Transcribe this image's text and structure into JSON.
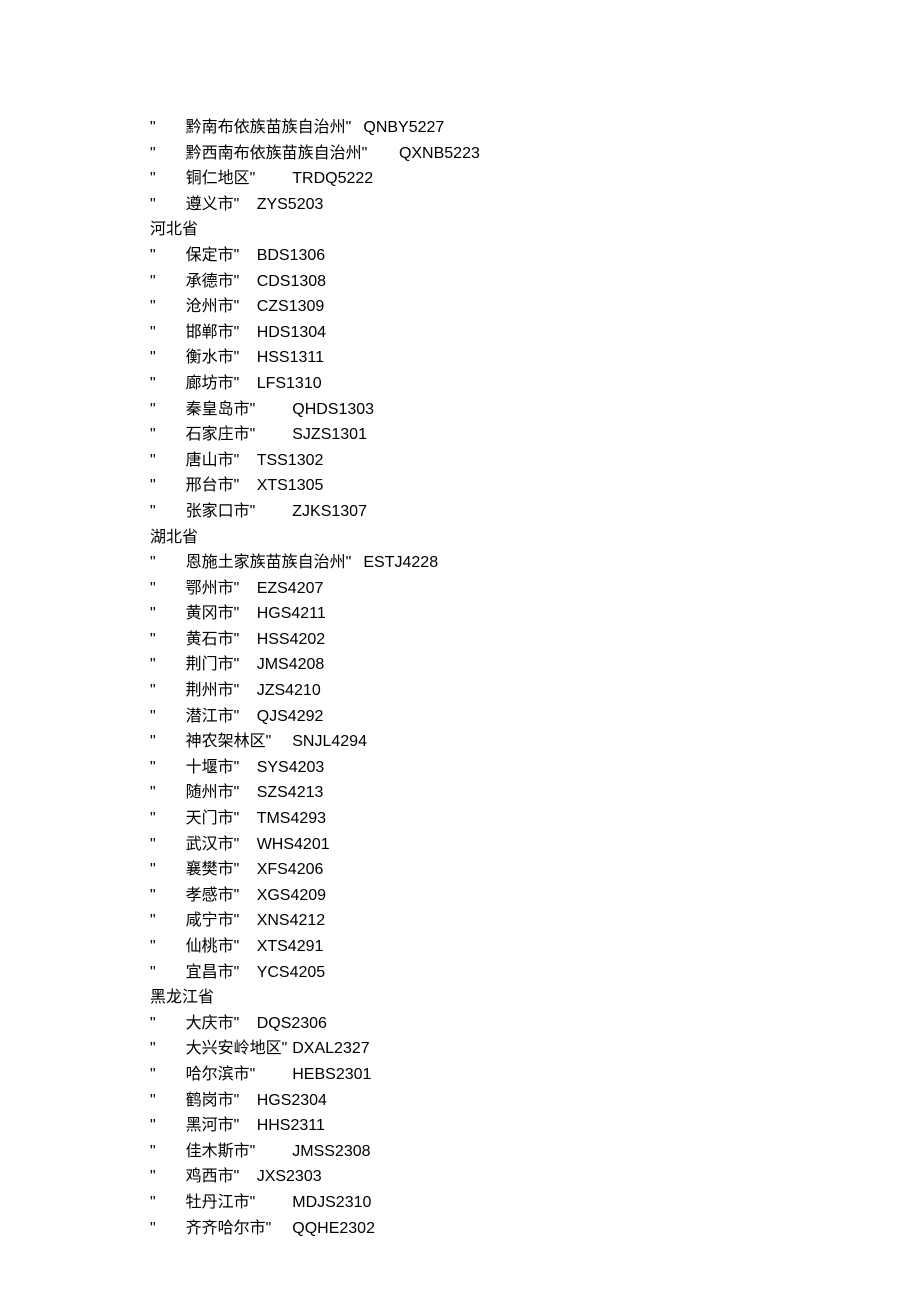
{
  "lines": [
    {
      "prefix": "\"\t",
      "city": "黔南布依族苗族自治州\"\t",
      "code": "QNBY5227"
    },
    {
      "prefix": "\"\t",
      "city": "黔西南布依族苗族自治州\"\t",
      "code": "QXNB5223"
    },
    {
      "prefix": "\"\t",
      "city": "铜仁地区\"\t",
      "code": "TRDQ5222"
    },
    {
      "prefix": "\"\t",
      "city": "遵义市\"\t",
      "code": "ZYS5203"
    },
    {
      "province": "河北省"
    },
    {
      "prefix": "\"\t",
      "city": "保定市\"\t",
      "code": "BDS1306"
    },
    {
      "prefix": "\"\t",
      "city": "承德市\"\t",
      "code": "CDS1308"
    },
    {
      "prefix": "\"\t",
      "city": "沧州市\"\t",
      "code": "CZS1309"
    },
    {
      "prefix": "\"\t",
      "city": "邯郸市\"\t",
      "code": "HDS1304"
    },
    {
      "prefix": "\"\t",
      "city": "衡水市\"\t",
      "code": "HSS1311"
    },
    {
      "prefix": "\"\t",
      "city": "廊坊市\"\t",
      "code": "LFS1310"
    },
    {
      "prefix": "\"\t",
      "city": "秦皇岛市\"\t",
      "code": "QHDS1303"
    },
    {
      "prefix": "\"\t",
      "city": "石家庄市\"\t",
      "code": "SJZS1301"
    },
    {
      "prefix": "\"\t",
      "city": "唐山市\"\t",
      "code": "TSS1302"
    },
    {
      "prefix": "\"\t",
      "city": "邢台市\"\t",
      "code": "XTS1305"
    },
    {
      "prefix": "\"\t",
      "city": "张家口市\"\t",
      "code": "ZJKS1307"
    },
    {
      "province": "湖北省"
    },
    {
      "prefix": "\"\t",
      "city": "恩施土家族苗族自治州\"\t",
      "code": "ESTJ4228"
    },
    {
      "prefix": "\"\t",
      "city": "鄂州市\"\t",
      "code": "EZS4207"
    },
    {
      "prefix": "\"\t",
      "city": "黄冈市\"\t",
      "code": "HGS4211"
    },
    {
      "prefix": "\"\t",
      "city": "黄石市\"\t",
      "code": "HSS4202"
    },
    {
      "prefix": "\"\t",
      "city": "荆门市\"\t",
      "code": "JMS4208"
    },
    {
      "prefix": "\"\t",
      "city": "荆州市\"\t",
      "code": "JZS4210"
    },
    {
      "prefix": "\"\t",
      "city": "潜江市\"\t",
      "code": "QJS4292"
    },
    {
      "prefix": "\"\t",
      "city": "神农架林区\"\t",
      "code": "SNJL4294"
    },
    {
      "prefix": "\"\t",
      "city": "十堰市\"\t",
      "code": "SYS4203"
    },
    {
      "prefix": "\"\t",
      "city": "随州市\"\t",
      "code": "SZS4213"
    },
    {
      "prefix": "\"\t",
      "city": "天门市\"\t",
      "code": "TMS4293"
    },
    {
      "prefix": "\"\t",
      "city": "武汉市\"\t",
      "code": "WHS4201"
    },
    {
      "prefix": "\"\t",
      "city": "襄樊市\"\t",
      "code": "XFS4206"
    },
    {
      "prefix": "\"\t",
      "city": "孝感市\"\t",
      "code": "XGS4209"
    },
    {
      "prefix": "\"\t",
      "city": "咸宁市\"\t",
      "code": "XNS4212"
    },
    {
      "prefix": "\"\t",
      "city": "仙桃市\"\t",
      "code": "XTS4291"
    },
    {
      "prefix": "\"\t",
      "city": "宜昌市\"\t",
      "code": "YCS4205"
    },
    {
      "province": "黑龙江省"
    },
    {
      "prefix": "\"\t",
      "city": "大庆市\"\t",
      "code": "DQS2306"
    },
    {
      "prefix": "\"\t",
      "city": "大兴安岭地区\"\t",
      "code": "DXAL2327"
    },
    {
      "prefix": "\"\t",
      "city": "哈尔滨市\"\t",
      "code": "HEBS2301"
    },
    {
      "prefix": "\"\t",
      "city": "鹤岗市\"\t",
      "code": "HGS2304"
    },
    {
      "prefix": "\"\t",
      "city": "黑河市\"\t",
      "code": "HHS2311"
    },
    {
      "prefix": "\"\t",
      "city": "佳木斯市\"\t",
      "code": "JMSS2308"
    },
    {
      "prefix": "\"\t",
      "city": "鸡西市\"\t",
      "code": "JXS2303"
    },
    {
      "prefix": "\"\t",
      "city": "牡丹江市\"\t",
      "code": "MDJS2310"
    },
    {
      "prefix": "\"\t",
      "city": "齐齐哈尔市\"\t",
      "code": "QQHE2302"
    }
  ]
}
